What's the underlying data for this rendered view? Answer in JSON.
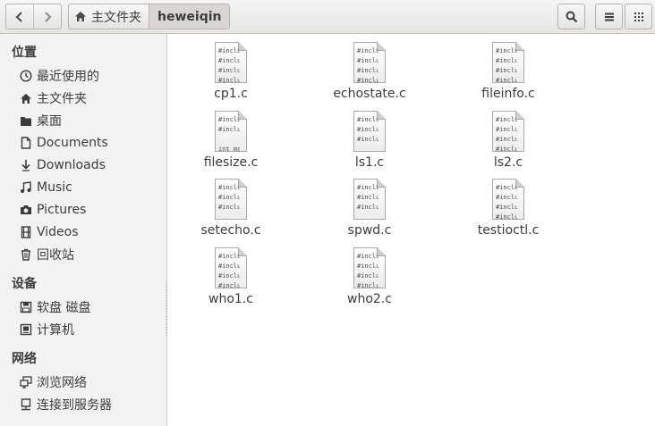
{
  "header": {
    "back_icon": "chevron-left-icon",
    "forward_icon": "chevron-right-icon",
    "home_crumb": "主文件夹",
    "current_crumb": "heweiqin",
    "search_icon": "search-icon",
    "list_view_icon": "list-view-icon",
    "grid_view_icon": "grid-view-icon"
  },
  "sidebar": {
    "places_title": "位置",
    "places": [
      {
        "label": "最近使用的",
        "icon": "clock-icon"
      },
      {
        "label": "主文件夹",
        "icon": "home-icon"
      },
      {
        "label": "桌面",
        "icon": "folder-icon"
      },
      {
        "label": "Documents",
        "icon": "document-icon"
      },
      {
        "label": "Downloads",
        "icon": "download-icon"
      },
      {
        "label": "Music",
        "icon": "music-icon"
      },
      {
        "label": "Pictures",
        "icon": "camera-icon"
      },
      {
        "label": "Videos",
        "icon": "film-icon"
      },
      {
        "label": "回收站",
        "icon": "trash-icon"
      }
    ],
    "devices_title": "设备",
    "devices": [
      {
        "label": "软盘 磁盘",
        "icon": "floppy-icon"
      },
      {
        "label": "计算机",
        "icon": "computer-icon"
      }
    ],
    "network_title": "网络",
    "network": [
      {
        "label": "浏览网络",
        "icon": "network-icon"
      },
      {
        "label": "连接到服务器",
        "icon": "server-icon"
      }
    ]
  },
  "files": [
    {
      "name": "cp1.c",
      "preview": [
        "#inclu",
        "#inclu",
        "#inclu",
        "#inclu"
      ]
    },
    {
      "name": "echostate.c",
      "preview": [
        "#inclu",
        "#inclu",
        "#inclu",
        "#inclu"
      ]
    },
    {
      "name": "fileinfo.c",
      "preview": [
        "#inclu",
        "#inclu",
        "#inclu",
        "#inclu"
      ]
    },
    {
      "name": "filesize.c",
      "preview": [
        "#inclu",
        "#inclu",
        "",
        "int ma"
      ]
    },
    {
      "name": "ls1.c",
      "preview": [
        "#inclu",
        "#inclu",
        "#inclu",
        ""
      ]
    },
    {
      "name": "ls2.c",
      "preview": [
        "#inclu",
        "#inclu",
        "#inclu",
        "#inclu"
      ]
    },
    {
      "name": "setecho.c",
      "preview": [
        "#inclu",
        "#inclu",
        "#inclu",
        ""
      ]
    },
    {
      "name": "spwd.c",
      "preview": [
        "#inclu",
        "#inclu",
        "#inclu",
        ""
      ]
    },
    {
      "name": "testioctl.c",
      "preview": [
        "#inclu",
        "#inclu",
        "#inclu",
        "#inclu"
      ]
    },
    {
      "name": "who1.c",
      "preview": [
        "#inclu",
        "#inclu",
        "#inclu",
        "#inclu"
      ]
    },
    {
      "name": "who2.c",
      "preview": [
        "#inclu",
        "#inclu",
        "#inclu",
        "#inclu"
      ]
    }
  ]
}
